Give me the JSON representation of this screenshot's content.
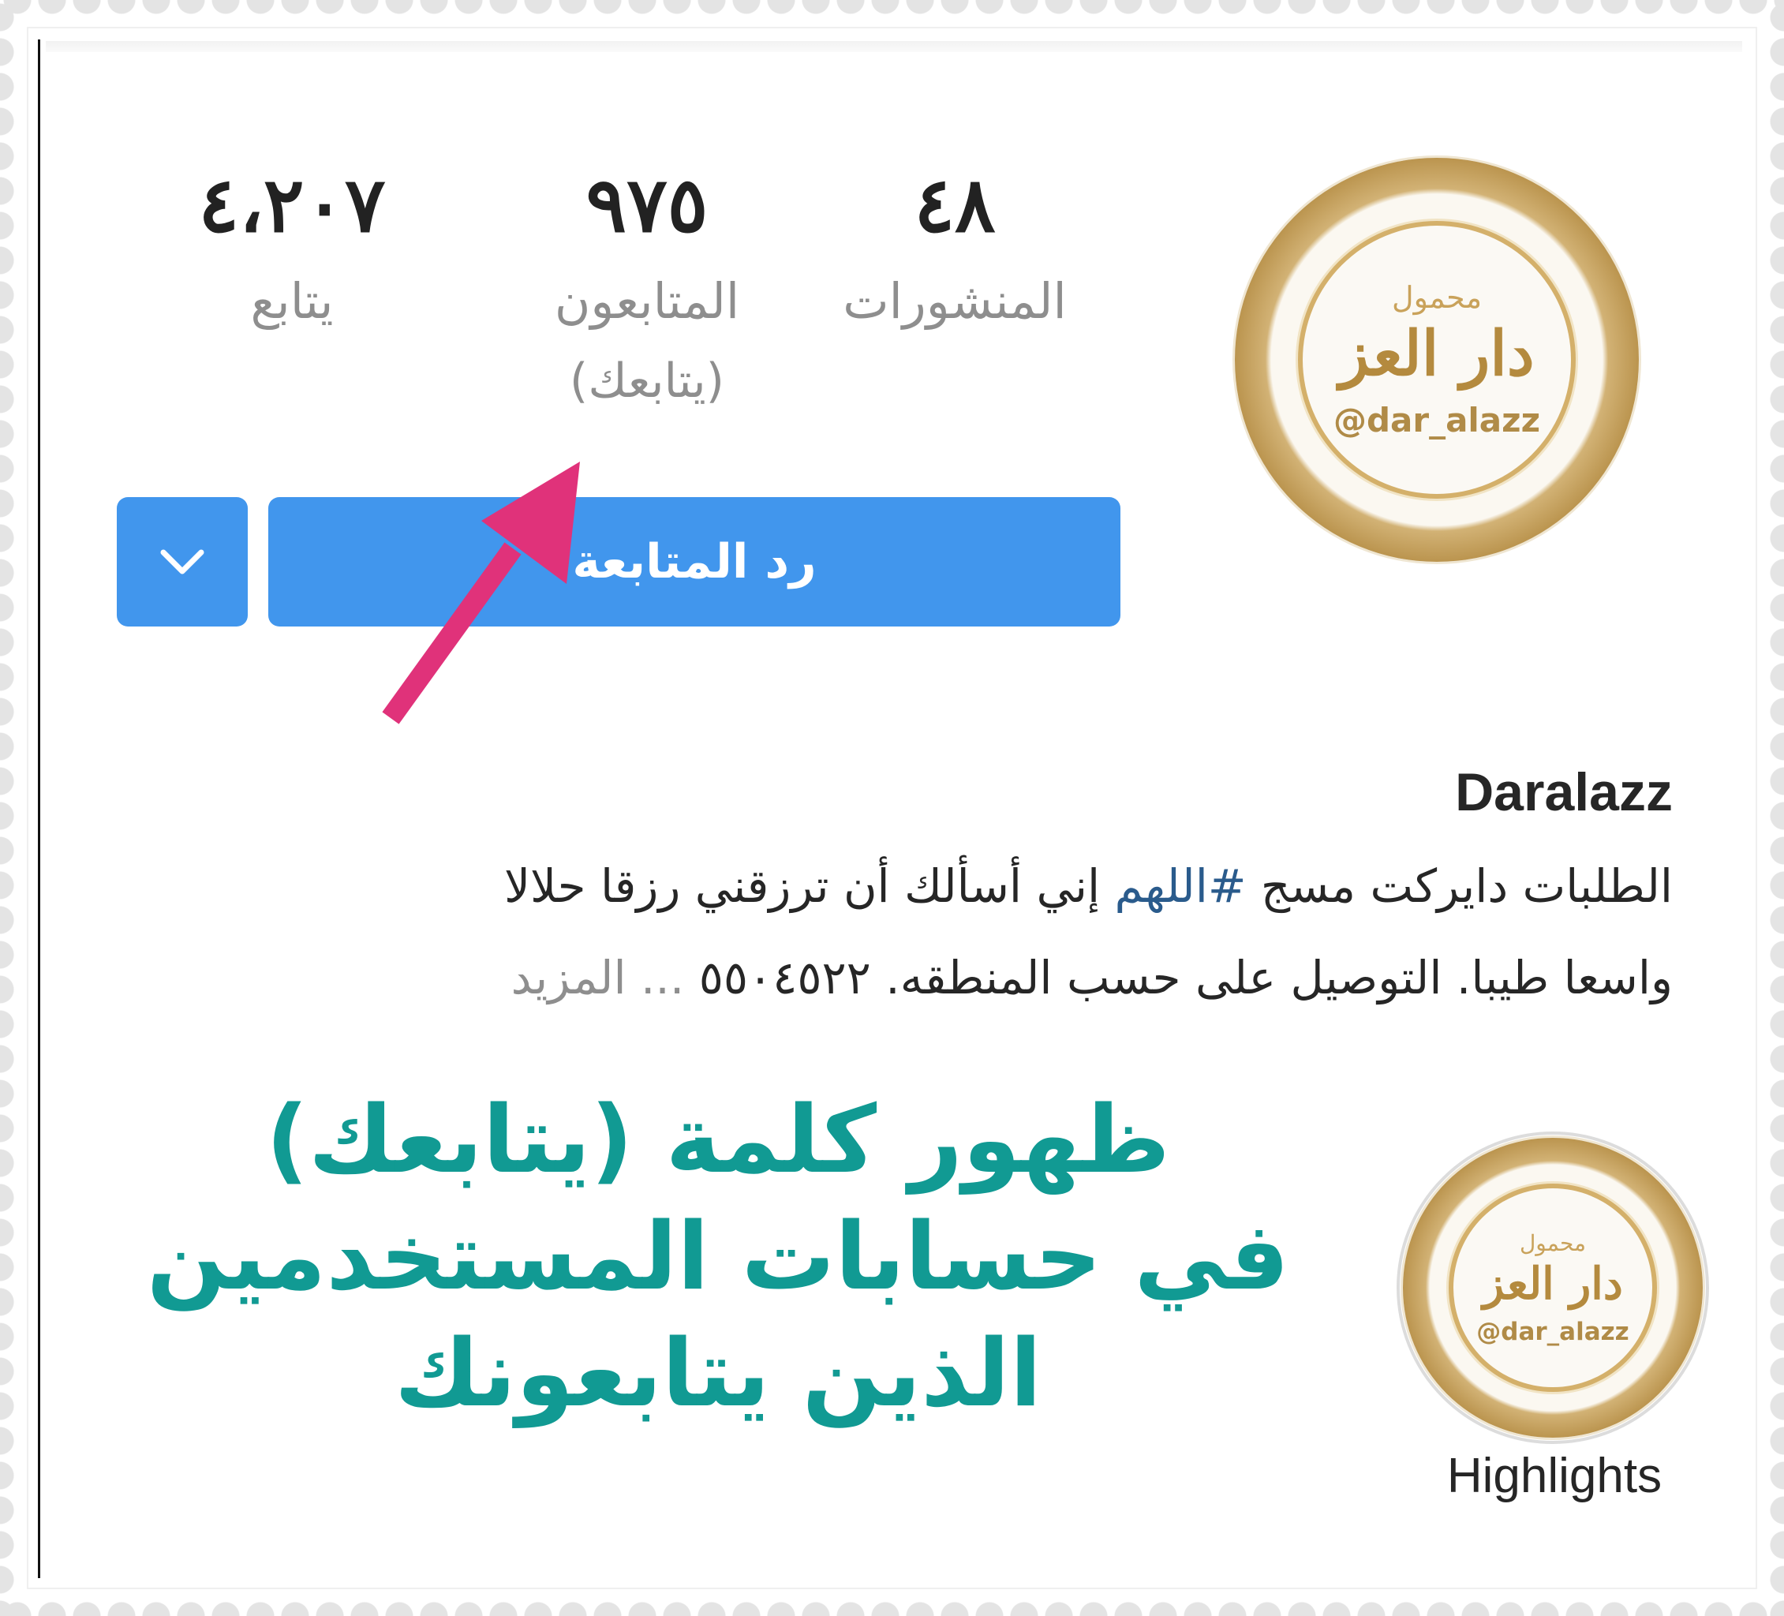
{
  "profile": {
    "stats": {
      "posts": {
        "value": "٤٨",
        "label": "المنشورات"
      },
      "followers": {
        "value": "٩٧٥",
        "label": "المتابعون",
        "sub": "(يتابعك)"
      },
      "following": {
        "value": "٤،٢٠٧",
        "label": "يتابع"
      }
    },
    "avatar": {
      "logo_top": "محمول",
      "logo_main": "دار العز",
      "logo_handle": "@dar_alazz"
    },
    "follow_button_label": "رد المتابعة",
    "username": "Daralazz",
    "bio": {
      "line1_before_hashtag": "الطلبات دايركت مسج ",
      "hashtag": "#اللهم",
      "line1_after_hashtag": " إني أسألك أن ترزقني رزقا حلالا",
      "line2": "واسعا طيبا. التوصيل على حسب المنطقه. ٥٥٠٤٥٢٢",
      "more": "... المزيد"
    },
    "highlight": {
      "label": "Highlights",
      "logo_top": "محمول",
      "logo_main": "دار العز",
      "logo_handle": "@dar_alazz"
    }
  },
  "annotation": {
    "line1": "ظهور كلمة (يتابعك)",
    "line2": "في حسابات المستخدمين",
    "line3": "الذين يتابعونك"
  },
  "colors": {
    "button_blue": "#4196ed",
    "caption_teal": "#119a93",
    "arrow_pink": "#e0327a",
    "hashtag_blue": "#2a5b8c"
  },
  "icons": {
    "dropdown": "chevron-down-icon",
    "arrow": "arrow-icon"
  }
}
